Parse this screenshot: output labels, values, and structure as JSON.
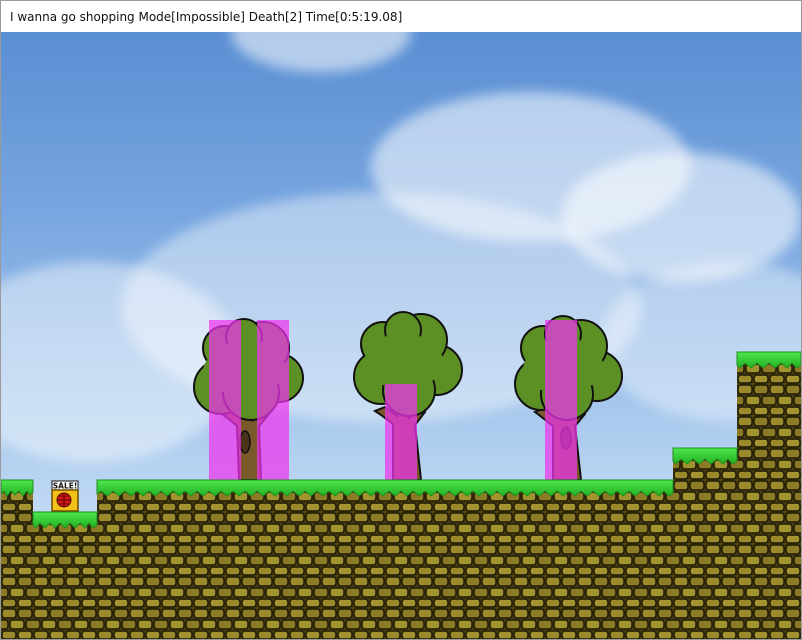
{
  "window": {
    "title": "I wanna go shopping Mode[Impossible] Death[2] Time[0:5:19.08]"
  },
  "game": {
    "save_sign_label": "SALE!",
    "colors": {
      "grass": "#36d736",
      "grass_dark": "#1f9e1f",
      "brick_base": "#7a6a1e",
      "brick_face": "#9b8a2c",
      "brick_outline": "#2a2408",
      "tree_leaves": "#5c8f24",
      "tree_trunk": "#7a5a2a",
      "magenta_zone": "#ee33ee",
      "sign_yellow": "#f2c21a",
      "sign_red": "#d01818"
    },
    "icons": [
      "save-point-icon",
      "tree-icon",
      "brick-block-icon"
    ]
  }
}
